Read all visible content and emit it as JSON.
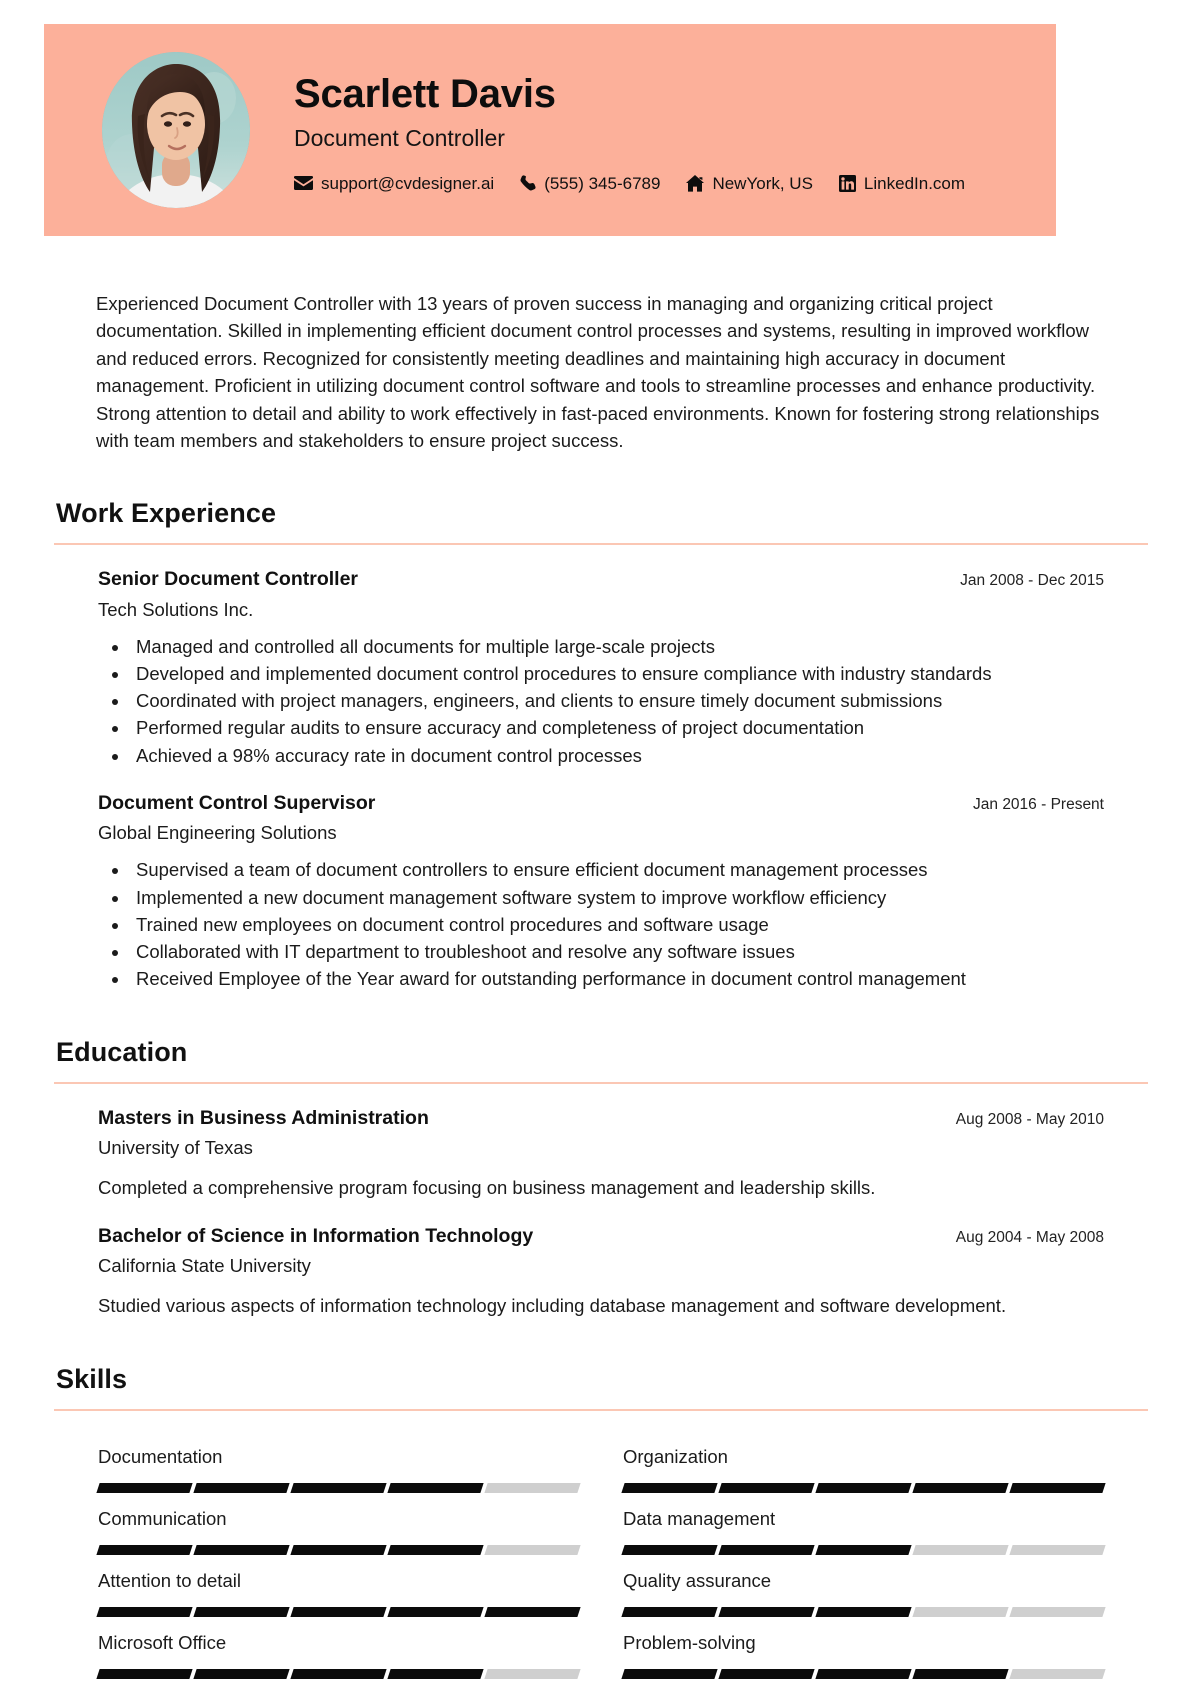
{
  "theme": {
    "header_bg": "#fcb09a",
    "rule_color": "#fbc7b4",
    "skill_filled": "#0b0b0b",
    "skill_empty": "#cfcfcf",
    "text_color": "#1b1b1b"
  },
  "header": {
    "name": "Scarlett Davis",
    "job_title": "Document Controller",
    "contacts": [
      {
        "icon": "envelope-icon",
        "label": "support@cvdesigner.ai"
      },
      {
        "icon": "phone-icon",
        "label": "(555) 345-6789"
      },
      {
        "icon": "home-icon",
        "label": "NewYork, US"
      },
      {
        "icon": "linkedin-icon",
        "label": "LinkedIn.com"
      }
    ]
  },
  "summary": {
    "text": "Experienced Document Controller with 13 years of proven success in managing and organizing critical project documentation. Skilled in implementing efficient document control processes and systems, resulting in improved workflow and reduced errors. Recognized for consistently meeting deadlines and maintaining high accuracy in document management. Proficient in utilizing document control software and tools to streamline processes and enhance productivity. Strong attention to detail and ability to work effectively in fast-paced environments. Known for fostering strong relationships with team members and stakeholders to ensure project success."
  },
  "work_experience": {
    "title": "Work Experience",
    "entries": [
      {
        "role": "Senior Document Controller",
        "organization": "Tech Solutions Inc.",
        "date": "Jan 2008 - Dec 2015",
        "bullets": [
          "Managed and controlled all documents for multiple large-scale projects",
          "Developed and implemented document control procedures to ensure compliance with industry standards",
          "Coordinated with project managers, engineers, and clients to ensure timely document submissions",
          "Performed regular audits to ensure accuracy and completeness of project documentation",
          "Achieved a 98% accuracy rate in document control processes"
        ]
      },
      {
        "role": "Document Control Supervisor",
        "organization": "Global Engineering Solutions",
        "date": "Jan 2016 - Present",
        "bullets": [
          "Supervised a team of document controllers to ensure efficient document management processes",
          "Implemented a new document management software system to improve workflow efficiency",
          "Trained new employees on document control procedures and software usage",
          "Collaborated with IT department to troubleshoot and resolve any software issues",
          "Received Employee of the Year award for outstanding performance in document control management"
        ]
      }
    ]
  },
  "education": {
    "title": "Education",
    "entries": [
      {
        "degree": "Masters in Business Administration",
        "school": "University of Texas",
        "date": "Aug 2008 - May 2010",
        "description": "Completed a comprehensive program focusing on business management and leadership skills."
      },
      {
        "degree": "Bachelor of Science in Information Technology",
        "school": "California State University",
        "date": "Aug 2004 - May 2008",
        "description": "Studied various aspects of information technology including database management and software development."
      }
    ]
  },
  "skills": {
    "title": "Skills",
    "segments_total": 5,
    "items": [
      {
        "name": "Documentation",
        "level": 4
      },
      {
        "name": "Organization",
        "level": 5
      },
      {
        "name": "Communication",
        "level": 4
      },
      {
        "name": "Data management",
        "level": 3
      },
      {
        "name": "Attention to detail",
        "level": 5
      },
      {
        "name": "Quality assurance",
        "level": 3
      },
      {
        "name": "Microsoft Office",
        "level": 4
      },
      {
        "name": "Problem-solving",
        "level": 4
      }
    ]
  }
}
